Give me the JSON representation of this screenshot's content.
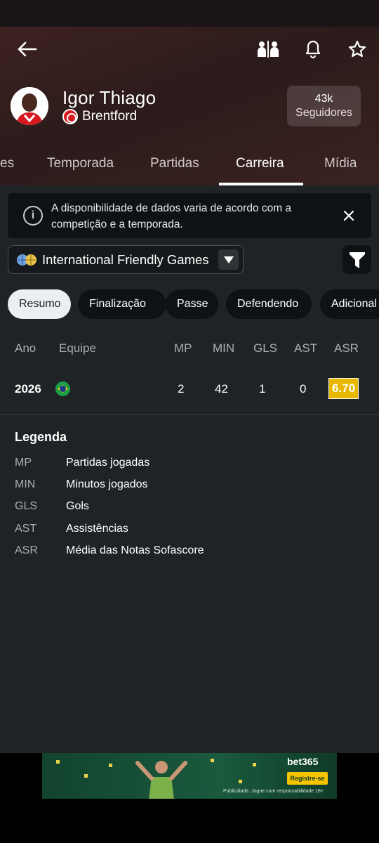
{
  "header": {
    "player_name": "Igor Thiago",
    "club_name": "Brentford",
    "followers_count": "43k",
    "followers_label": "Seguidores",
    "icons": [
      "back-arrow-icon",
      "compare-icon",
      "bell-icon",
      "star-icon"
    ]
  },
  "tabs": [
    {
      "label": "es"
    },
    {
      "label": "Temporada"
    },
    {
      "label": "Partidas"
    },
    {
      "label": "Carreira",
      "active": true
    },
    {
      "label": "Mídia"
    }
  ],
  "notice": {
    "text": "A disponibilidade de dados varia de acordo com a competição e a temporada."
  },
  "competition_select": {
    "selected": "International Friendly Games"
  },
  "stat_chips": [
    {
      "label": "Resumo",
      "active": true
    },
    {
      "label": "Finalização"
    },
    {
      "label": "Passe"
    },
    {
      "label": "Defendendo"
    },
    {
      "label": "Adicional"
    }
  ],
  "table": {
    "headers": {
      "year": "Ano",
      "team": "Equipe",
      "mp": "MP",
      "min": "MIN",
      "gls": "GLS",
      "ast": "AST",
      "asr": "ASR"
    },
    "rows": [
      {
        "year": "2026",
        "team_flag": "brazil-flag-icon",
        "mp": "2",
        "min": "42",
        "gls": "1",
        "ast": "0",
        "asr": "6.70"
      }
    ]
  },
  "legend": {
    "title": "Legenda",
    "items": [
      {
        "abbr": "MP",
        "desc": "Partidas jogadas"
      },
      {
        "abbr": "MIN",
        "desc": "Minutos jogados"
      },
      {
        "abbr": "GLS",
        "desc": "Gols"
      },
      {
        "abbr": "AST",
        "desc": "Assistências"
      },
      {
        "abbr": "ASR",
        "desc": "Média das Notas Sofascore"
      }
    ]
  },
  "ad": {
    "brand": "bet365",
    "cta": "Registre-se",
    "disclaimer": "Publicidade. Jogue com responsabilidade 18+"
  },
  "colors": {
    "header_bg": "#2c1b1b",
    "content_bg": "#1f2326",
    "rating_badge": "#e8b800",
    "chip_active_bg": "#eceff1"
  }
}
